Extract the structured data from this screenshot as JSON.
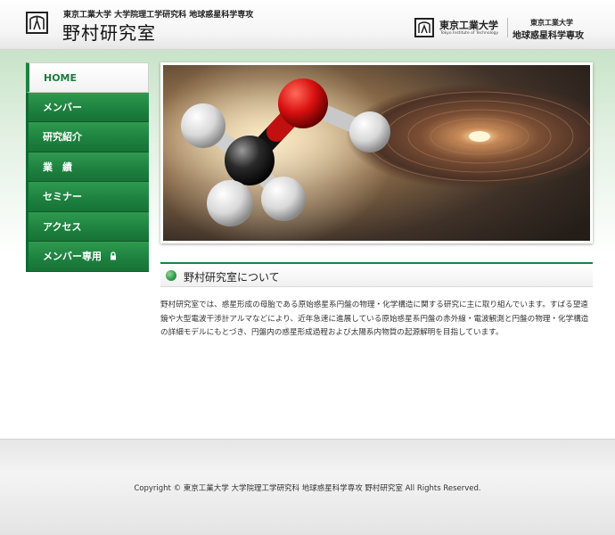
{
  "header": {
    "affiliation": "東京工業大学 大学院理工学研究科 地球惑星科学専攻",
    "lab_name": "野村研究室",
    "university_name": "東京工業大学",
    "university_en": "Tokyo Institute of Technology",
    "dept_line1": "東京工業大学",
    "dept_line2": "地球惑星科学専攻"
  },
  "nav": {
    "items": [
      {
        "label": "HOME",
        "active": true
      },
      {
        "label": "メンバー"
      },
      {
        "label": "研究紹介"
      },
      {
        "label": "業　績"
      },
      {
        "label": "セミナー"
      },
      {
        "label": "アクセス"
      },
      {
        "label": "メンバー専用",
        "icon": "lock-icon"
      }
    ]
  },
  "hero": {
    "image": "methanol-molecule-over-protoplanetary-disk"
  },
  "about": {
    "title": "野村研究室について",
    "body": "野村研究室では、惑星形成の母胎である原始惑星系円盤の物理・化学構造に関する研究に主に取り組んでいます。すばる望遠鏡や大型電波干渉計アルマなどにより、近年急速に進展している原始惑星系円盤の赤外線・電波観測と円盤の物理・化学構造の詳細モデルにもとづき、円盤内の惑星形成過程および太陽系内物質の起源解明を目指しています。"
  },
  "footer": {
    "copyright": "Copyright © 東京工業大学 大学院理工学研究科 地球惑星科学専攻 野村研究室 All Rights Reserved."
  },
  "colors": {
    "accent": "#1e8240",
    "nav_bg": "#1e8240",
    "band": "#c8e3c8"
  }
}
